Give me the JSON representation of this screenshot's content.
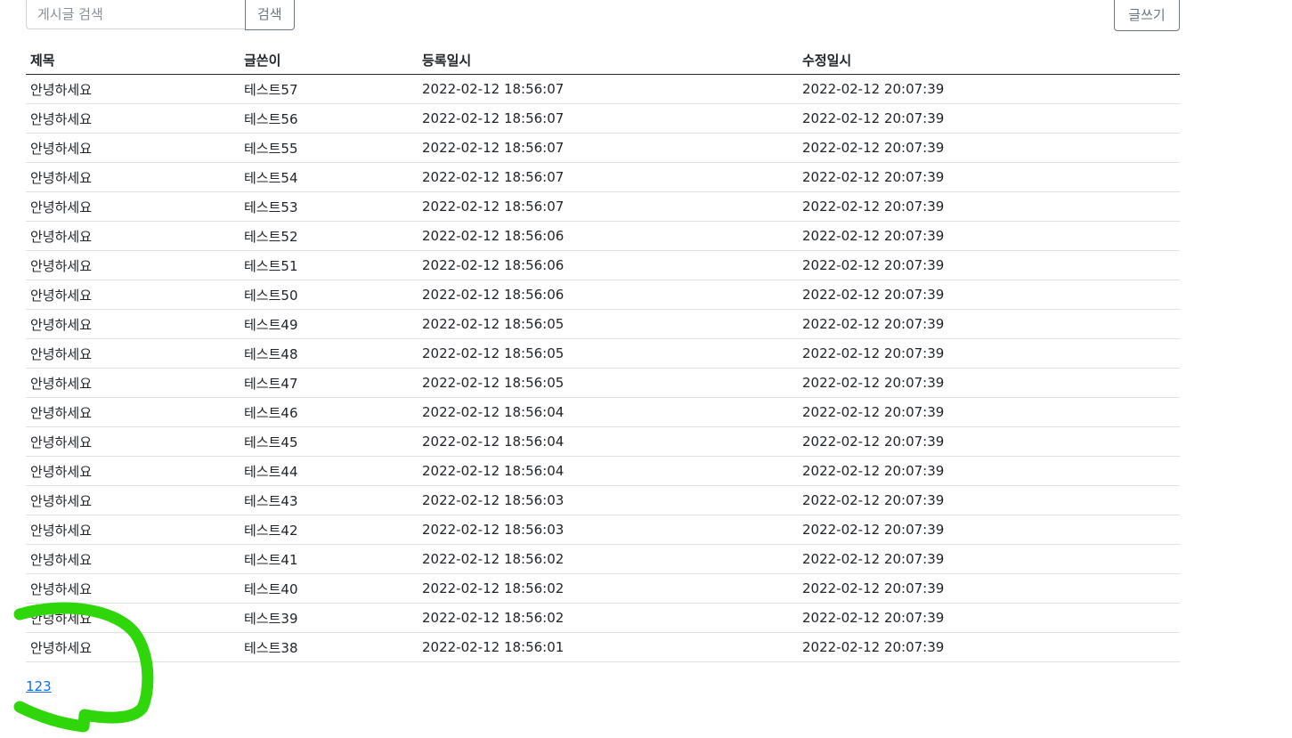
{
  "search": {
    "placeholder": "게시글 검색",
    "button_label": "검색"
  },
  "toolbar": {
    "write_label": "글쓰기"
  },
  "table": {
    "headers": [
      "제목",
      "글쓴이",
      "등록일시",
      "수정일시"
    ],
    "rows": [
      [
        "안녕하세요",
        "테스트57",
        "2022-02-12 18:56:07",
        "2022-02-12 20:07:39"
      ],
      [
        "안녕하세요",
        "테스트56",
        "2022-02-12 18:56:07",
        "2022-02-12 20:07:39"
      ],
      [
        "안녕하세요",
        "테스트55",
        "2022-02-12 18:56:07",
        "2022-02-12 20:07:39"
      ],
      [
        "안녕하세요",
        "테스트54",
        "2022-02-12 18:56:07",
        "2022-02-12 20:07:39"
      ],
      [
        "안녕하세요",
        "테스트53",
        "2022-02-12 18:56:07",
        "2022-02-12 20:07:39"
      ],
      [
        "안녕하세요",
        "테스트52",
        "2022-02-12 18:56:06",
        "2022-02-12 20:07:39"
      ],
      [
        "안녕하세요",
        "테스트51",
        "2022-02-12 18:56:06",
        "2022-02-12 20:07:39"
      ],
      [
        "안녕하세요",
        "테스트50",
        "2022-02-12 18:56:06",
        "2022-02-12 20:07:39"
      ],
      [
        "안녕하세요",
        "테스트49",
        "2022-02-12 18:56:05",
        "2022-02-12 20:07:39"
      ],
      [
        "안녕하세요",
        "테스트48",
        "2022-02-12 18:56:05",
        "2022-02-12 20:07:39"
      ],
      [
        "안녕하세요",
        "테스트47",
        "2022-02-12 18:56:05",
        "2022-02-12 20:07:39"
      ],
      [
        "안녕하세요",
        "테스트46",
        "2022-02-12 18:56:04",
        "2022-02-12 20:07:39"
      ],
      [
        "안녕하세요",
        "테스트45",
        "2022-02-12 18:56:04",
        "2022-02-12 20:07:39"
      ],
      [
        "안녕하세요",
        "테스트44",
        "2022-02-12 18:56:04",
        "2022-02-12 20:07:39"
      ],
      [
        "안녕하세요",
        "테스트43",
        "2022-02-12 18:56:03",
        "2022-02-12 20:07:39"
      ],
      [
        "안녕하세요",
        "테스트42",
        "2022-02-12 18:56:03",
        "2022-02-12 20:07:39"
      ],
      [
        "안녕하세요",
        "테스트41",
        "2022-02-12 18:56:02",
        "2022-02-12 20:07:39"
      ],
      [
        "안녕하세요",
        "테스트40",
        "2022-02-12 18:56:02",
        "2022-02-12 20:07:39"
      ],
      [
        "안녕하세요",
        "테스트39",
        "2022-02-12 18:56:02",
        "2022-02-12 20:07:39"
      ],
      [
        "안녕하세요",
        "테스트38",
        "2022-02-12 18:56:01",
        "2022-02-12 20:07:39"
      ]
    ]
  },
  "pagination": {
    "pages": [
      "1",
      "2",
      "3"
    ]
  },
  "colors": {
    "link": "#0d6efd",
    "annotation_stroke": "#2fd60a",
    "button_border": "#6c757d"
  }
}
